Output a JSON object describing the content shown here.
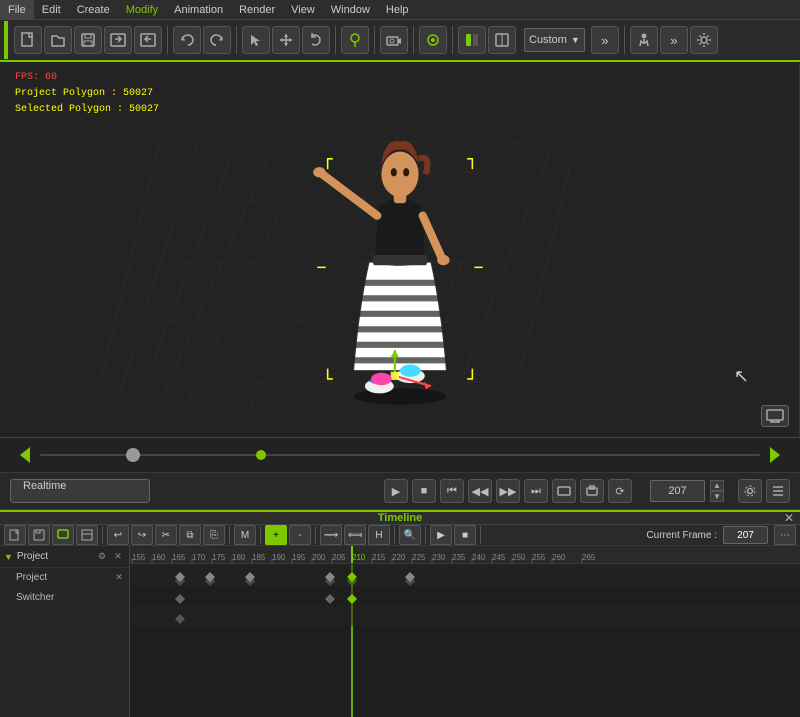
{
  "menubar": {
    "items": [
      "File",
      "Edit",
      "Create",
      "Modify",
      "Animation",
      "Render",
      "View",
      "Window",
      "Help"
    ]
  },
  "toolbar": {
    "dropdown_label": "Custom",
    "icons": [
      "new",
      "open",
      "save",
      "import",
      "export",
      "undo",
      "redo",
      "select",
      "move",
      "rotate",
      "scale",
      "draw",
      "paint",
      "camera",
      "viewport",
      "render-preview",
      "layout"
    ]
  },
  "viewport": {
    "hud": {
      "fps": "FPS: 60",
      "project_polygon": "Project Polygon : 50027",
      "selected_polygon": "Selected Polygon : 50027"
    }
  },
  "playback": {
    "realtime_label": "Realtime",
    "frame_value": "207"
  },
  "timeline": {
    "header_label": "Timeline",
    "close_symbol": "✕",
    "tracks": [
      {
        "label": "Project",
        "expanded": true,
        "sub_tracks": [
          {
            "label": "Project"
          },
          {
            "label": "Switcher"
          }
        ]
      }
    ],
    "ruler_marks": [
      155,
      160,
      165,
      170,
      175,
      180,
      185,
      190,
      195,
      200,
      205,
      210,
      215,
      220,
      225,
      230,
      235,
      240,
      245,
      250,
      255,
      260,
      265
    ],
    "current_frame": "207",
    "current_frame_label": "Current Frame :"
  },
  "icons": {
    "play": "▶",
    "stop": "■",
    "step_start": "⏮",
    "step_back": "◀◀",
    "step_fwd": "▶▶",
    "step_end": "⏭",
    "loop": "↻",
    "settings": "⚙",
    "close": "✕",
    "arrow_down": "▼",
    "arrow_right": "▶",
    "chevron_right": "❯",
    "plus": "+",
    "minus": "−",
    "x_mark": "✕",
    "eye": "👁",
    "lock": "🔒"
  }
}
